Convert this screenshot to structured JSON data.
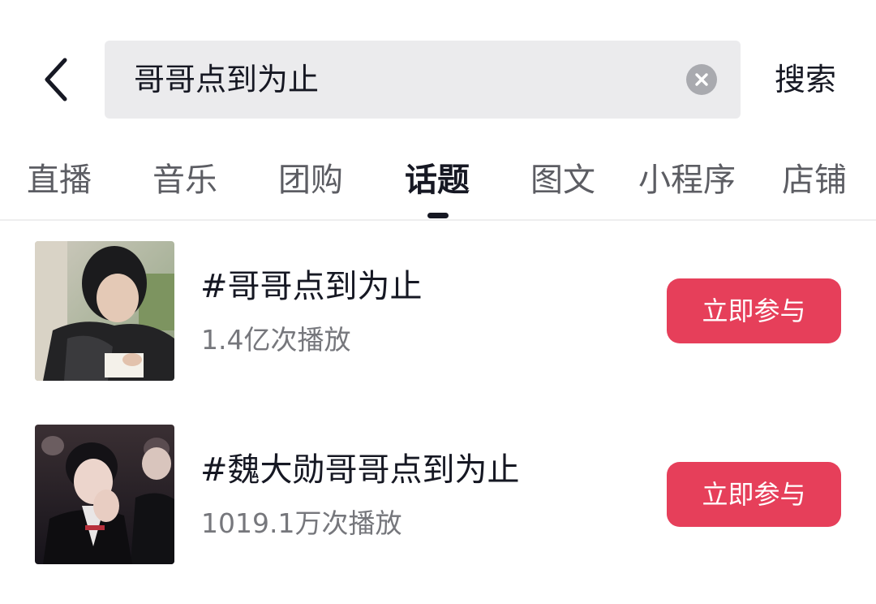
{
  "search": {
    "query": "哥哥点到为止",
    "submit_label": "搜索"
  },
  "tabs": [
    {
      "label": "直播",
      "active": false
    },
    {
      "label": "音乐",
      "active": false
    },
    {
      "label": "团购",
      "active": false
    },
    {
      "label": "话题",
      "active": true
    },
    {
      "label": "图文",
      "active": false
    },
    {
      "label": "小程序",
      "active": false
    },
    {
      "label": "店铺",
      "active": false
    }
  ],
  "results": [
    {
      "title": "#哥哥点到为止",
      "views": "1.4亿次播放",
      "action_label": "立即参与"
    },
    {
      "title": "#魏大勋哥哥点到为止",
      "views": "1019.1万次播放",
      "action_label": "立即参与"
    }
  ],
  "colors": {
    "accent": "#e63f5a",
    "search_background": "#ebebed",
    "text_primary": "#161823",
    "text_secondary": "#76777c"
  },
  "icons": {
    "back": "chevron-left-icon",
    "clear": "clear-circle-icon"
  }
}
